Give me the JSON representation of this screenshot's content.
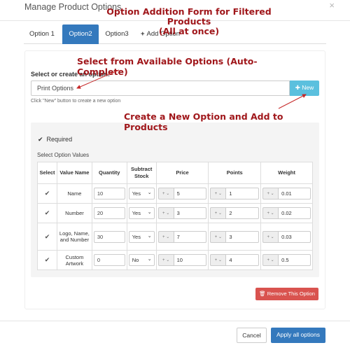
{
  "modal": {
    "title": "Manage Product Options",
    "close": "×"
  },
  "annotations": {
    "form_title_line1": "Option Addition Form for Filtered Products",
    "form_title_line2": "(All at once)",
    "select_hint": "Select from Available Options (Auto-Complete)",
    "create_hint": "Create a New Option and Add to Products",
    "color": "#a0171b"
  },
  "tabs": [
    {
      "label": "Option 1",
      "active": false
    },
    {
      "label": "Option2",
      "active": true
    },
    {
      "label": "Option3",
      "active": false
    },
    {
      "label": "Add Option",
      "icon": "plus-icon",
      "icon_glyph": "+"
    }
  ],
  "option": {
    "label": "Select or create an option:",
    "value": "Print Options",
    "new_button": "New",
    "new_icon": "plus-circle-icon",
    "help": "Click \"New\" button to create a new option"
  },
  "values": {
    "required_label": "Required",
    "required_checked": true,
    "section_label": "Select Option Values",
    "headers": {
      "select": "Select",
      "value_name": "Value Name",
      "quantity": "Quantity",
      "subtract": "Subtract Stock",
      "price": "Price",
      "points": "Points",
      "weight": "Weight"
    },
    "rows": [
      {
        "selected": true,
        "name": "Name",
        "quantity": "10",
        "subtract": "Yes",
        "price_prefix": "+",
        "price": "5",
        "points_prefix": "+",
        "points": "1",
        "weight_prefix": "+",
        "weight": "0.01"
      },
      {
        "selected": true,
        "name": "Number",
        "quantity": "20",
        "subtract": "Yes",
        "price_prefix": "+",
        "price": "3",
        "points_prefix": "+",
        "points": "2",
        "weight_prefix": "+",
        "weight": "0.02"
      },
      {
        "selected": true,
        "name": "Logo, Name, and Number",
        "quantity": "30",
        "subtract": "Yes",
        "price_prefix": "+",
        "price": "7",
        "points_prefix": "+",
        "points": "3",
        "weight_prefix": "+",
        "weight": "0.03"
      },
      {
        "selected": true,
        "name": "Custom Artwork",
        "quantity": "0",
        "subtract": "No",
        "price_prefix": "+",
        "price": "10",
        "points_prefix": "+",
        "points": "4",
        "weight_prefix": "+",
        "weight": "0.5"
      }
    ]
  },
  "remove_button": "Remove This Option",
  "footer": {
    "cancel": "Cancel",
    "apply": "Apply all options"
  },
  "colors": {
    "primary": "#3479bd",
    "info": "#5bc0de",
    "danger": "#d9534f"
  }
}
